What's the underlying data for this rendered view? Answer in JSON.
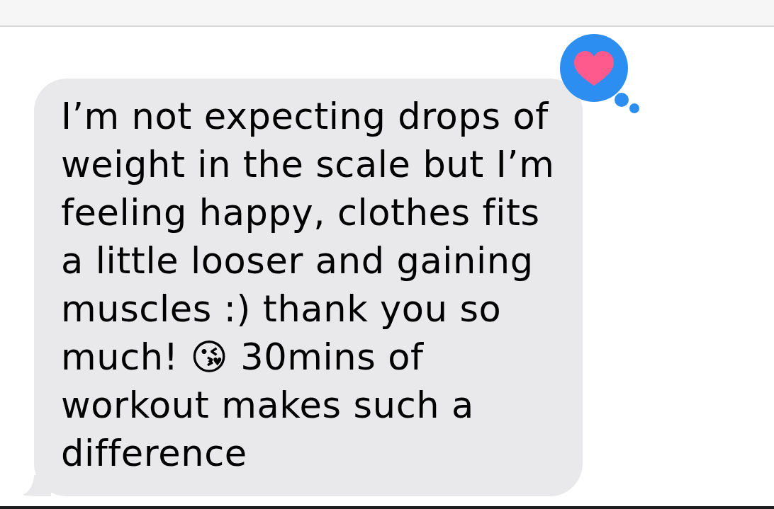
{
  "messages": [
    {
      "text": "I’m not expecting drops of weight in the scale but I’m feeling happy, clothes fits a little looser and gaining muscles :) thank you so much! 😘 30mins of workout makes such a difference",
      "tapback": {
        "kind": "heart"
      }
    }
  ]
}
